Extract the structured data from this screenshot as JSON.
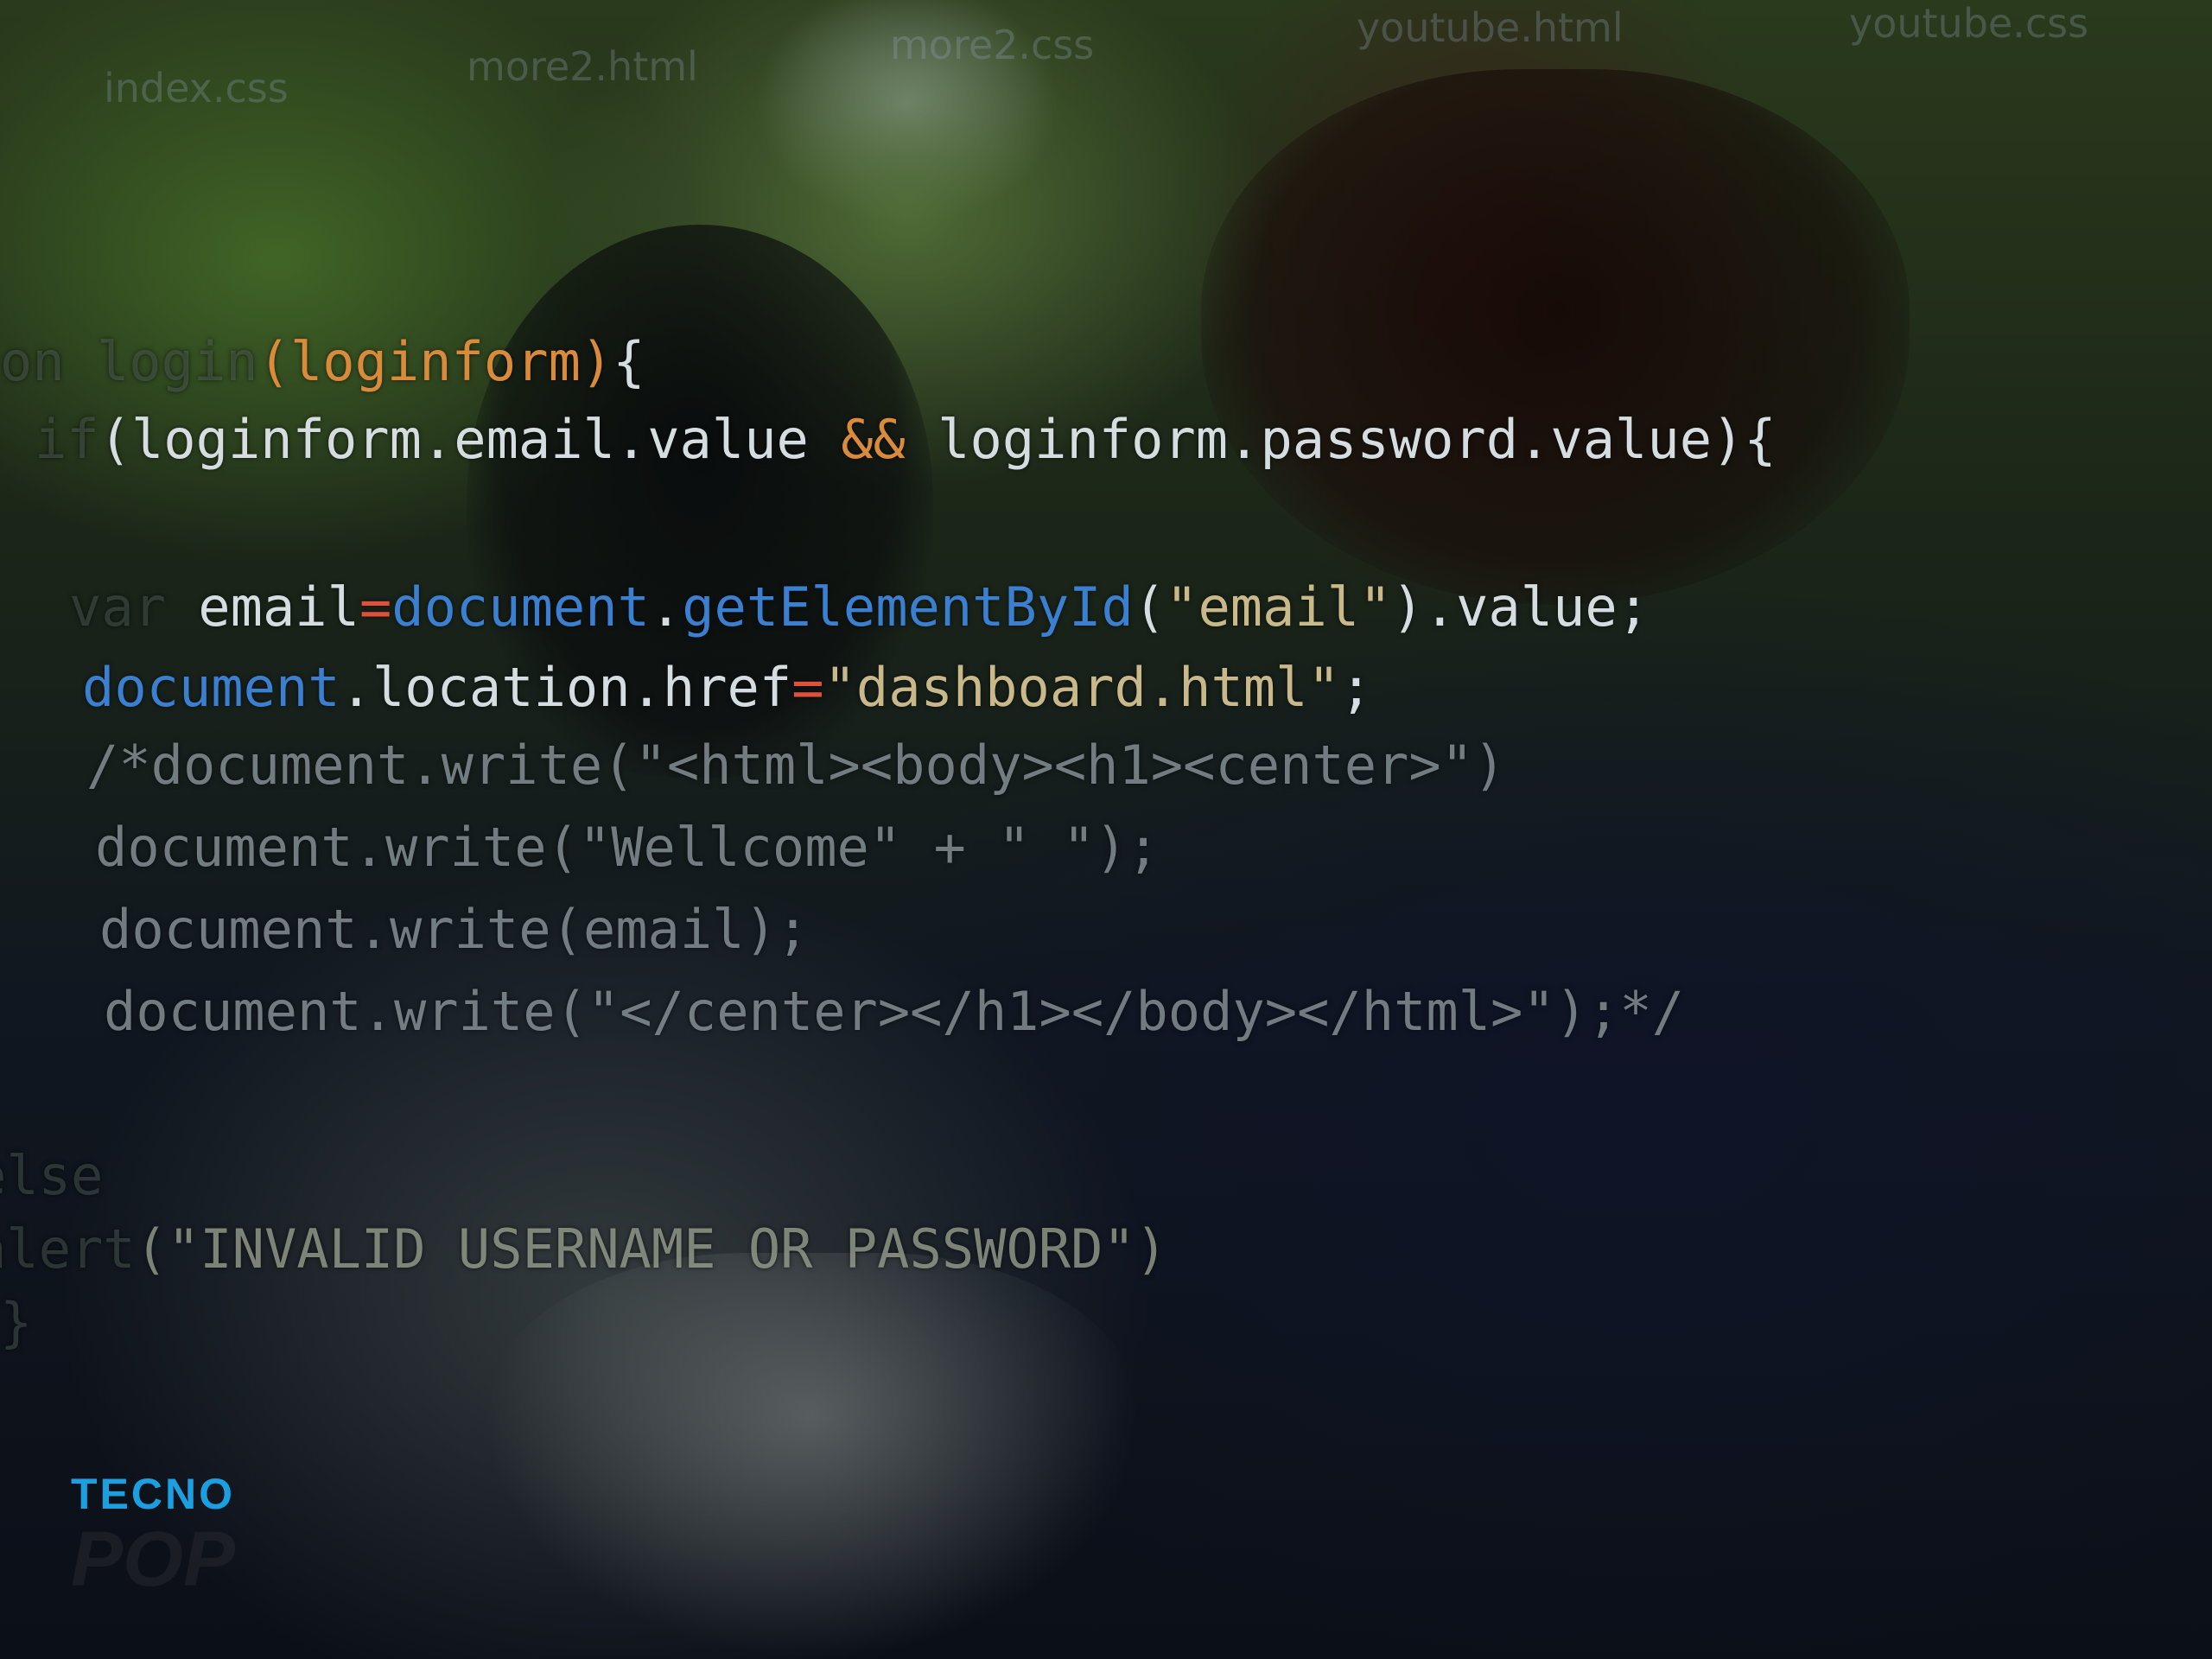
{
  "editor": {
    "tabs": [
      {
        "label": "index.css"
      },
      {
        "label": "more2.html"
      },
      {
        "label": "more2.css"
      },
      {
        "label": "youtube.html"
      },
      {
        "label": "youtube.css"
      }
    ],
    "lines": [
      {
        "segments": [
          {
            "text": "on login",
            "style": "dim"
          },
          {
            "text": "(loginform)",
            "style": "orange"
          },
          {
            "text": "{",
            "style": "white"
          }
        ]
      },
      {
        "segments": [
          {
            "text": "if",
            "style": "dim"
          },
          {
            "text": "(loginform.email.value ",
            "style": "white"
          },
          {
            "text": "&&",
            "style": "orange"
          },
          {
            "text": " loginform.password.value){",
            "style": "white"
          }
        ]
      },
      {
        "segments": [
          {
            "text": "var",
            "style": "dim"
          },
          {
            "text": " email",
            "style": "white"
          },
          {
            "text": "=",
            "style": "red"
          },
          {
            "text": "document",
            "style": "blue"
          },
          {
            "text": ".",
            "style": "white"
          },
          {
            "text": "getElementById",
            "style": "blue"
          },
          {
            "text": "(",
            "style": "white"
          },
          {
            "text": "\"email\"",
            "style": "string"
          },
          {
            "text": ").value;",
            "style": "white"
          }
        ]
      },
      {
        "segments": [
          {
            "text": "document",
            "style": "blue"
          },
          {
            "text": ".location.href",
            "style": "white"
          },
          {
            "text": "=",
            "style": "red"
          },
          {
            "text": "\"dashboard.html\"",
            "style": "string"
          },
          {
            "text": ";",
            "style": "white"
          }
        ]
      },
      {
        "segments": [
          {
            "text": "/*document.write(\"<html><body><h1><center>\")",
            "style": "comment"
          }
        ]
      },
      {
        "segments": [
          {
            "text": "document.write(\"Wellcome\" + \" \");",
            "style": "comment"
          }
        ]
      },
      {
        "segments": [
          {
            "text": "document.write(email);",
            "style": "comment"
          }
        ]
      },
      {
        "segments": [
          {
            "text": "document.write(\"</center></h1></body></html>\");*/",
            "style": "comment"
          }
        ]
      },
      {
        "segments": [
          {
            "text": "else",
            "style": "dim"
          }
        ]
      },
      {
        "segments": [
          {
            "text": "alert",
            "style": "dim"
          },
          {
            "text": "(\"INVALID USERNAME OR PASSWORD\")",
            "style": "alert"
          }
        ]
      },
      {
        "segments": [
          {
            "text": "}",
            "style": "dim"
          }
        ]
      }
    ]
  },
  "watermark": {
    "brand": "TECNO",
    "model": "POP"
  },
  "colors": {
    "background": "#0d1118",
    "code_text": "#d6dde0",
    "keyword_orange": "#d98a3a",
    "dom_blue": "#3a7fd0",
    "operator_red": "#e0503a",
    "string": "#c9b98a",
    "brand_blue": "#1b9fe0"
  }
}
